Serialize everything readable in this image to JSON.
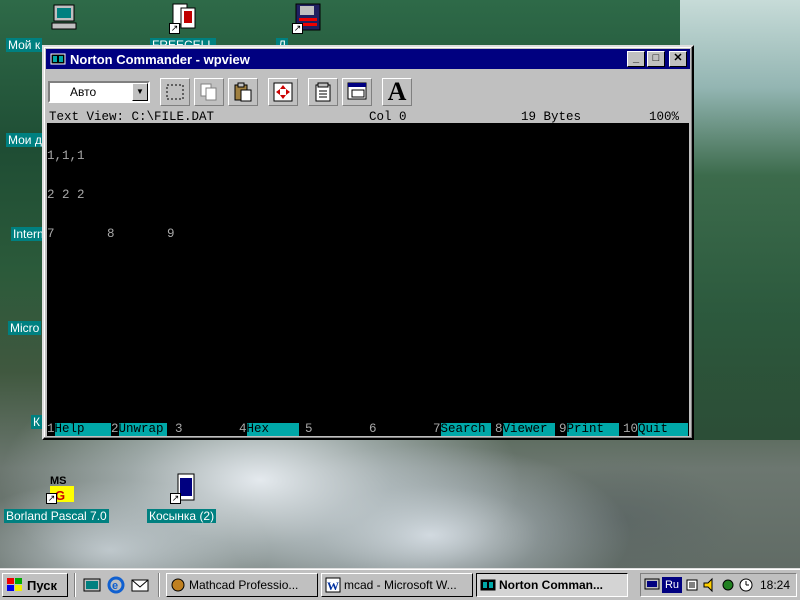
{
  "desktop": {
    "icons": {
      "my_computer": "Мой к",
      "my_docs": "Мои д",
      "internet": "Intern",
      "microsoft": "Micro",
      "k_item": "К",
      "freecell": "FREECELL",
      "third_top": "Д",
      "borland": "Borland Pascal 7.0",
      "solitaire": "Косынка (2)"
    }
  },
  "window": {
    "title": "Norton Commander - wpview",
    "min_label": "_",
    "max_label": "□",
    "close_label": "✕",
    "font_combo": "Авто",
    "font_tool_label": "A"
  },
  "viewer": {
    "status": {
      "mode": "Text View: C:\\FILE.DAT",
      "col": "Col 0",
      "size": "19 Bytes",
      "percent": "100%"
    },
    "lines": [
      "1,1,1",
      "2 2 2",
      "7       8       9"
    ],
    "fkeys": [
      {
        "num": "1",
        "label": "Help"
      },
      {
        "num": "2",
        "label": "Unwrap"
      },
      {
        "num": "3",
        "label": ""
      },
      {
        "num": "4",
        "label": "Hex"
      },
      {
        "num": "5",
        "label": ""
      },
      {
        "num": "6",
        "label": ""
      },
      {
        "num": "7",
        "label": "Search"
      },
      {
        "num": "8",
        "label": "Viewer"
      },
      {
        "num": "9",
        "label": "Print"
      },
      {
        "num": "10",
        "label": "Quit"
      }
    ]
  },
  "taskbar": {
    "start": "Пуск",
    "tasks": [
      "Mathcad Professio...",
      "mcad - Microsoft W...",
      "Norton Comman..."
    ],
    "lang": "Ru",
    "clock": "18:24"
  }
}
